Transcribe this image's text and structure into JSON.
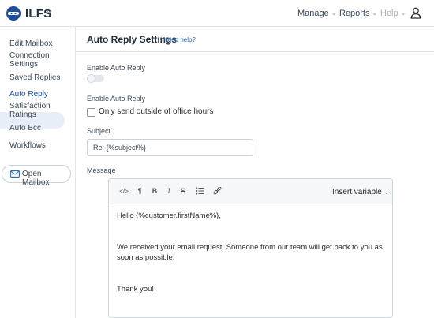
{
  "app": {
    "brand": "ILFS"
  },
  "nav": {
    "manage": "Manage",
    "reports": "Reports",
    "help": "Help"
  },
  "sidebar": {
    "items": [
      {
        "label": "Edit Mailbox"
      },
      {
        "label": "Connection Settings"
      },
      {
        "label": "Saved Replies"
      },
      {
        "label": "Auto Reply",
        "active": true
      },
      {
        "label": "Satisfaction Ratings"
      },
      {
        "label": "Auto Bcc"
      },
      {
        "label": "Workflows"
      }
    ],
    "open_mailbox": "Open Mailbox"
  },
  "page": {
    "title": "Auto Reply Settings",
    "help_link": "Need help?"
  },
  "form": {
    "enable_label": "Enable Auto Reply",
    "enable_value": false,
    "enable_label_2": "Enable Auto Reply",
    "office_hours_label": "Only send outside of office hours",
    "office_hours_checked": false,
    "subject_label": "Subject",
    "subject_value": "Re: {%subject%}",
    "message_label": "Message"
  },
  "editor": {
    "toolbar": {
      "code": "</>",
      "paragraph": "¶",
      "bold": "B",
      "italic": "I",
      "strike": "S",
      "insert_variable": "Insert variable"
    },
    "body": {
      "greeting": "Hello {%customer.firstName%},",
      "message": "We received your email request! Someone from our team will get back to you as soon as possible.",
      "closing": "Thank you!"
    }
  },
  "colors": {
    "accent": "#2b6cb0",
    "active_bg": "#e8eef8",
    "active_text": "#1b4f9a",
    "border": "#e3e6ea"
  },
  "icons": {
    "logo": "ninja-logo-icon",
    "user": "user-icon",
    "mail": "mail-icon",
    "list": "bullet-list-icon",
    "link": "link-icon"
  }
}
